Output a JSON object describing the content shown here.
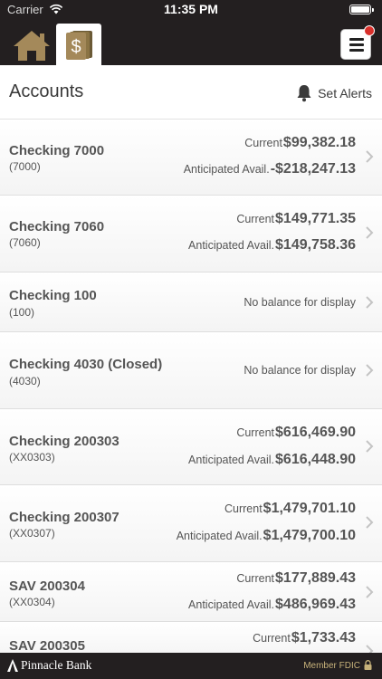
{
  "status_bar": {
    "carrier": "Carrier",
    "time": "11:35 PM",
    "battery_level": 1.0
  },
  "nav": {
    "home_icon": "home-icon",
    "accounts_icon": "dollar-ledger-icon",
    "menu_icon": "hamburger-menu-icon",
    "menu_has_notification": true
  },
  "header": {
    "title": "Accounts",
    "alerts_label": "Set Alerts",
    "alerts_icon": "bell-icon"
  },
  "accounts": [
    {
      "name": "Checking 7000",
      "number": "(7000)",
      "current_label": "Current",
      "current": "$99,382.18",
      "anticipated_label": "Anticipated Avail.",
      "anticipated": "-$218,247.13"
    },
    {
      "name": "Checking 7060",
      "number": "(7060)",
      "current_label": "Current",
      "current": "$149,771.35",
      "anticipated_label": "Anticipated Avail.",
      "anticipated": "$149,758.36"
    },
    {
      "name": "Checking 100",
      "number": "(100)",
      "no_balance": "No balance for display"
    },
    {
      "name": "Checking 4030 (Closed)",
      "number": "(4030)",
      "no_balance": "No balance for display"
    },
    {
      "name": "Checking 200303",
      "number": "(XX0303)",
      "current_label": "Current",
      "current": "$616,469.90",
      "anticipated_label": "Anticipated Avail.",
      "anticipated": "$616,448.90"
    },
    {
      "name": "Checking 200307",
      "number": "(XX0307)",
      "current_label": "Current",
      "current": "$1,479,701.10",
      "anticipated_label": "Anticipated Avail.",
      "anticipated": "$1,479,700.10"
    },
    {
      "name": "SAV 200304",
      "number": "(XX0304)",
      "current_label": "Current",
      "current": "$177,889.43",
      "anticipated_label": "Anticipated Avail.",
      "anticipated": "$486,969.43"
    },
    {
      "name": "SAV 200305",
      "number": "",
      "current_label": "Current",
      "current": "$1,733.43"
    }
  ],
  "footer": {
    "brand": "Pinnacle Bank",
    "fdic": "Member FDIC",
    "lock_icon": "lock-icon"
  },
  "colors": {
    "bar_background": "#231f20",
    "gold_accent": "#a4895a",
    "notification": "#d9302b"
  }
}
